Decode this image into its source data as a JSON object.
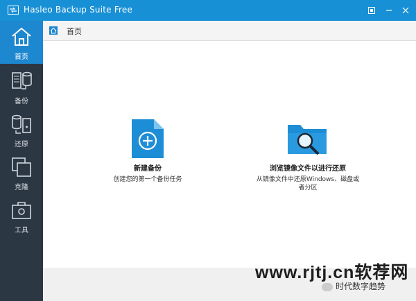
{
  "window": {
    "title": "Hasleo Backup Suite Free"
  },
  "sidebar": {
    "items": [
      {
        "label": "首页",
        "icon": "home-icon",
        "active": true
      },
      {
        "label": "备份",
        "icon": "backup-icon",
        "active": false
      },
      {
        "label": "还原",
        "icon": "restore-icon",
        "active": false
      },
      {
        "label": "克隆",
        "icon": "clone-icon",
        "active": false
      },
      {
        "label": "工具",
        "icon": "tools-icon",
        "active": false
      }
    ]
  },
  "breadcrumb": {
    "label": "首页"
  },
  "actions": {
    "new_backup": {
      "title": "新建备份",
      "desc": "创建您的第一个备份任务",
      "icon": "new-backup-file-icon"
    },
    "browse_image": {
      "title": "浏览镜像文件以进行还原",
      "desc_line1": "从镜像文件中还原Windows、磁盘或",
      "desc_line2": "者分区",
      "icon": "folder-search-icon"
    }
  },
  "watermark": {
    "text": "www.rjtj.cn软荐网",
    "subtext": "时代数字趋势"
  },
  "colors": {
    "titlebar": "#1890d6",
    "sidebar": "#2c3744",
    "accent": "#1d87cf"
  }
}
